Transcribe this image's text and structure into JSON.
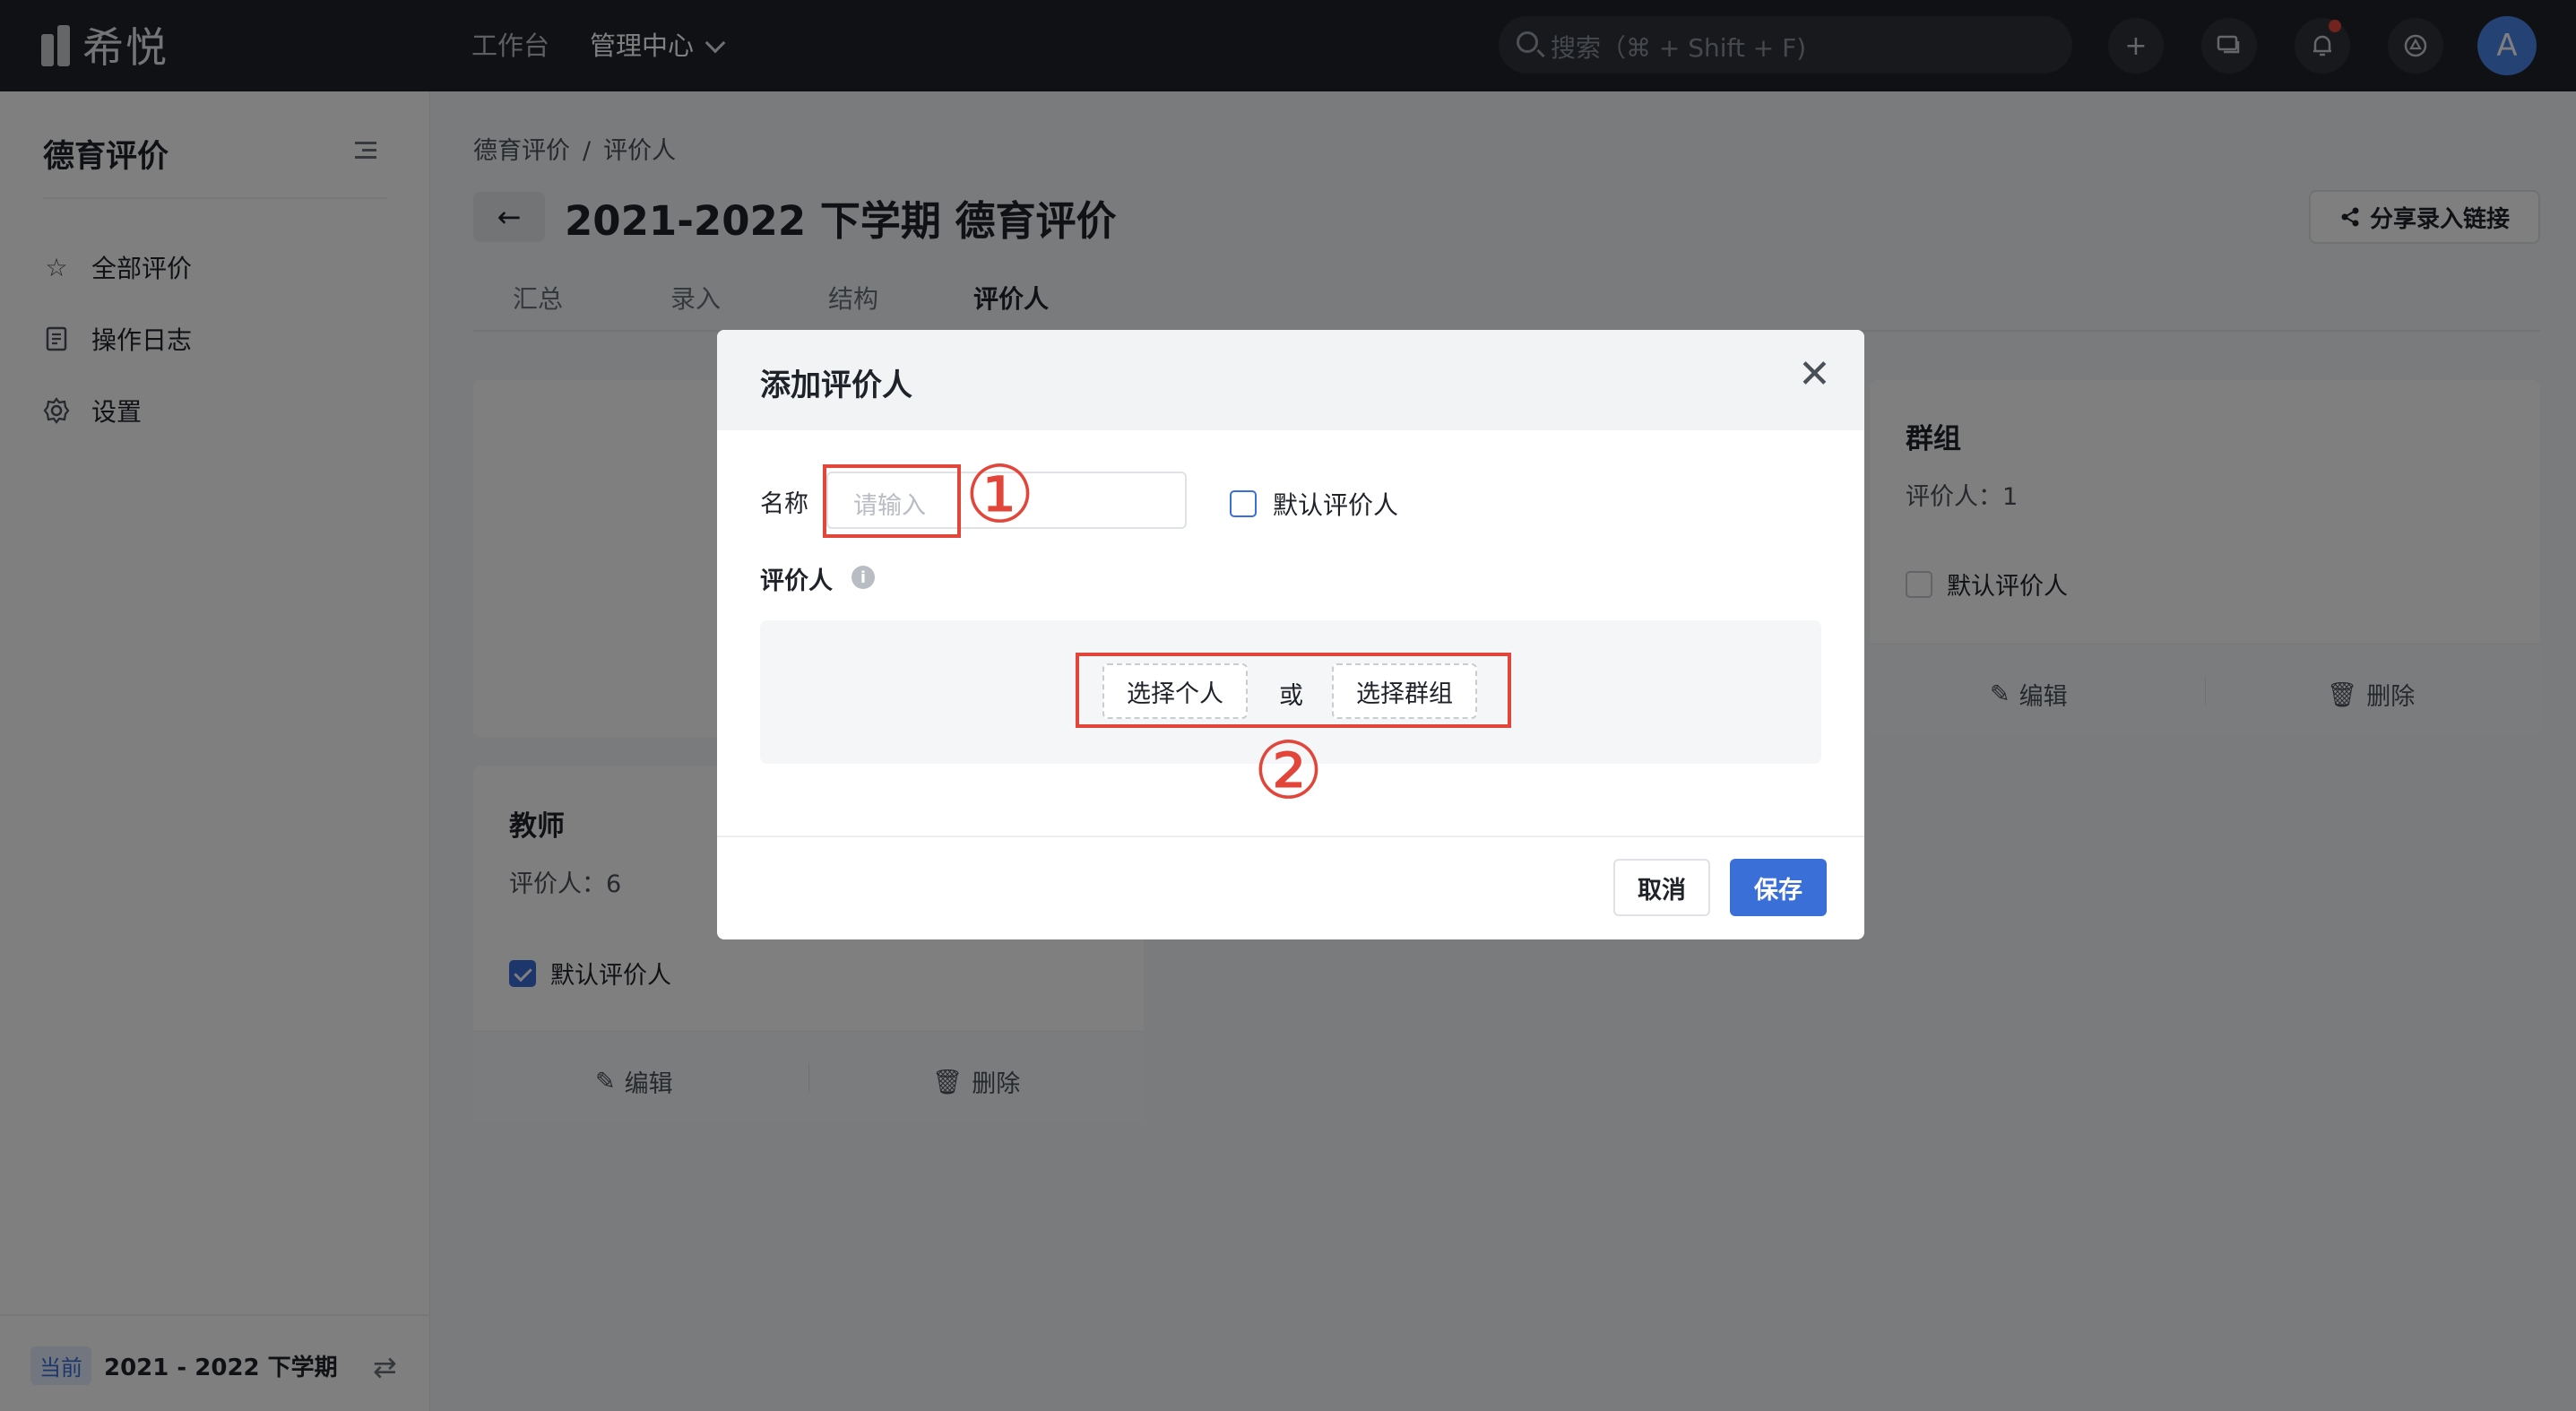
{
  "app": {
    "logo_text": "希悦"
  },
  "topbar": {
    "nav": [
      {
        "label": "工作台"
      },
      {
        "label": "管理中心"
      }
    ],
    "search_placeholder": "搜索（⌘ + Shift + F)",
    "add_glyph": "+",
    "avatar_letter": "A"
  },
  "sidebar": {
    "title": "德育评价",
    "items": [
      {
        "label": "全部评价",
        "icon": "star-icon"
      },
      {
        "label": "操作日志",
        "icon": "log-icon"
      },
      {
        "label": "设置",
        "icon": "gear-icon"
      }
    ],
    "term_badge": "当前",
    "term_label": "2021 - 2022 下学期"
  },
  "main": {
    "breadcrumb": [
      "德育评价",
      "评价人"
    ],
    "breadcrumb_sep": "/",
    "title": "2021-2022 下学期 德育评价",
    "share_label": "分享录入链接",
    "tabs": [
      {
        "label": "汇总"
      },
      {
        "label": "录入"
      },
      {
        "label": "结构"
      },
      {
        "label": "评价人"
      }
    ],
    "cards": [
      {
        "title": "群组",
        "count_label": "评价人：1",
        "default_label": "默认评价人",
        "default_checked": false,
        "edit_label": "编辑",
        "delete_label": "删除"
      },
      {
        "title": "教师",
        "count_label": "评价人：6",
        "default_label": "默认评价人",
        "default_checked": true,
        "edit_label": "编辑",
        "delete_label": "删除"
      }
    ]
  },
  "modal": {
    "title": "添加评价人",
    "name_label": "名称",
    "name_placeholder": "请输入",
    "default_checkbox_label": "默认评价人",
    "evaluator_label": "评价人",
    "select_person_label": "选择个人",
    "or_label": "或",
    "select_group_label": "选择群组",
    "cancel_label": "取消",
    "save_label": "保存",
    "annotation_1": "①",
    "annotation_2": "②"
  },
  "colors": {
    "topbar": "#1f2329",
    "primary": "#3b6fd8",
    "annotation_red": "#e2463a",
    "notification_dot": "#e2463a"
  }
}
